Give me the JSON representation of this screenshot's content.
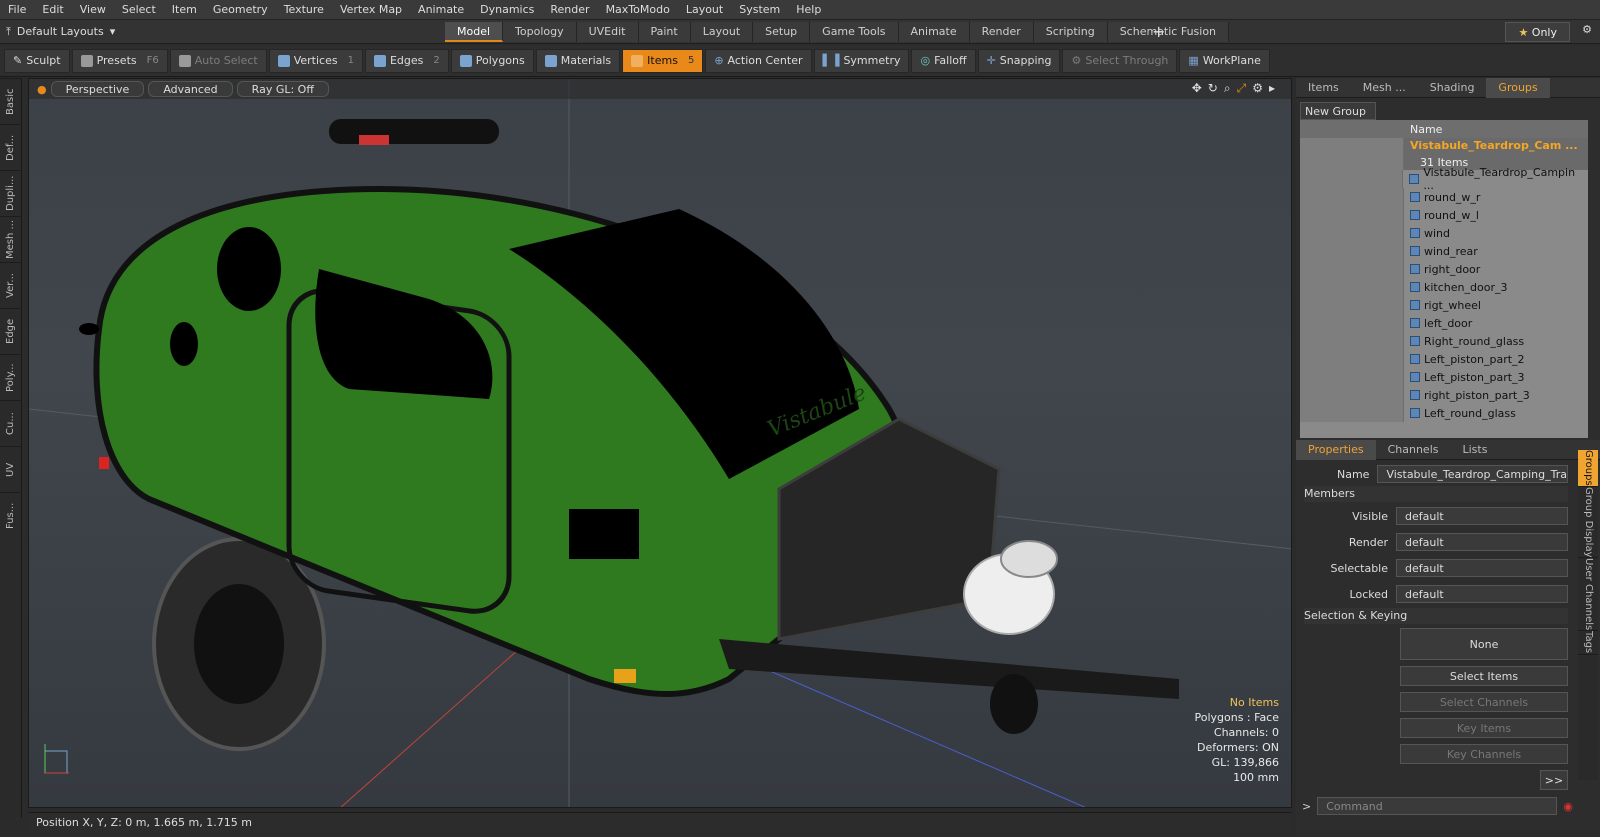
{
  "menu": [
    "File",
    "Edit",
    "View",
    "Select",
    "Item",
    "Geometry",
    "Texture",
    "Vertex Map",
    "Animate",
    "Dynamics",
    "Render",
    "MaxToModo",
    "Layout",
    "System",
    "Help"
  ],
  "layout_label": "Default Layouts",
  "mode_tabs": [
    "Model",
    "Topology",
    "UVEdit",
    "Paint",
    "Layout",
    "Setup",
    "Game Tools",
    "Animate",
    "Render",
    "Scripting",
    "Schematic Fusion"
  ],
  "only_label": "Only",
  "toolbar": {
    "sculpt": "Sculpt",
    "presets": "Presets",
    "presets_key": "F6",
    "auto_select": "Auto Select",
    "vertices": "Vertices",
    "vertices_num": "1",
    "edges": "Edges",
    "edges_num": "2",
    "polygons": "Polygons",
    "materials": "Materials",
    "items": "Items",
    "items_num": "5",
    "action_center": "Action Center",
    "symmetry": "Symmetry",
    "falloff": "Falloff",
    "snapping": "Snapping",
    "select_through": "Select Through",
    "workplane": "WorkPlane"
  },
  "left_tabs": [
    "Basic",
    "Def...",
    "Dupli...",
    "Mesh ...",
    "Ver...",
    "Edge",
    "Poly...",
    "Cu...",
    "UV",
    "Fus..."
  ],
  "viewport": {
    "perspective": "Perspective",
    "advanced": "Advanced",
    "raygl": "Ray GL: Off",
    "logo": "Vistabule",
    "info": {
      "no_items": "No Items",
      "polygons": "Polygons : Face",
      "channels": "Channels: 0",
      "deformers": "Deformers: ON",
      "gl": "GL: 139,866",
      "scale": "100 mm"
    }
  },
  "status": "Position X, Y, Z:   0 m, 1.665 m, 1.715 m",
  "right_tabs": [
    "Items",
    "Mesh ...",
    "Shading",
    "Groups"
  ],
  "new_group": "New Group",
  "tree_header": "Name",
  "group": {
    "name": "Vistabule_Teardrop_Cam ...",
    "count": "31 Items"
  },
  "tree_items": [
    "Vistabule_Teardrop_Campin ...",
    "round_w_r",
    "round_w_l",
    "wind",
    "wind_rear",
    "right_door",
    "kitchen_door_3",
    "rigt_wheel",
    "left_door",
    "Right_round_glass",
    "Left_piston_part_2",
    "Left_piston_part_3",
    "right_piston_part_3",
    "Left_round_glass"
  ],
  "prop_tabs": [
    "Properties",
    "Channels",
    "Lists"
  ],
  "props": {
    "name_label": "Name",
    "name_value": "Vistabule_Teardrop_Camping_Tra",
    "members": "Members",
    "visible_label": "Visible",
    "visible_value": "default",
    "render_label": "Render",
    "render_value": "default",
    "selectable_label": "Selectable",
    "selectable_value": "default",
    "locked_label": "Locked",
    "locked_value": "default",
    "sel_keying": "Selection & Keying",
    "none": "None",
    "select_items": "Select Items",
    "select_channels": "Select Channels",
    "key_items": "Key Items",
    "key_channels": "Key Channels",
    "more": ">>"
  },
  "side_vtabs": [
    "Groups",
    "Group Display",
    "User Channels",
    "Tags"
  ],
  "command_placeholder": "Command",
  "colors": {
    "accent": "#e8891a",
    "trailer": "#2f7a1f",
    "group_text": "#f5a623"
  }
}
